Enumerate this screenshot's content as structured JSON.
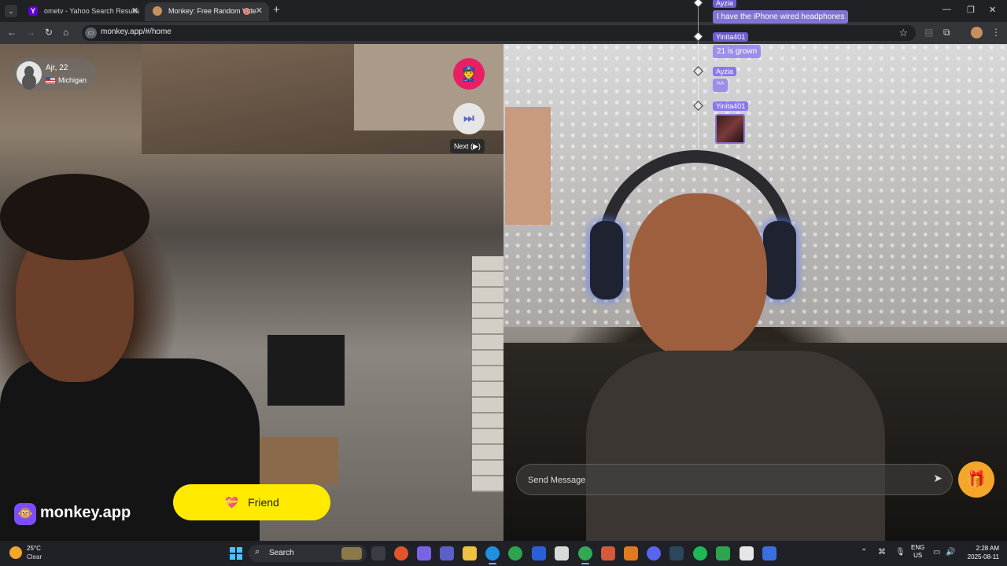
{
  "browser": {
    "tabs": [
      {
        "title": "ometv - Yahoo Search Results"
      },
      {
        "title": "Monkey: Free Random Vide"
      }
    ],
    "url": "monkey.app/#/home"
  },
  "caller": {
    "name": "Ajr, 22",
    "location": "Michigan"
  },
  "controls": {
    "next_tooltip": "Next (▶)",
    "friend_label": "Friend"
  },
  "brand": {
    "name": "monkey.app"
  },
  "chat": {
    "messages": [
      {
        "author": "Ayzia",
        "text": "I have the iPhone wired headphones"
      },
      {
        "author": "Yinita401",
        "text": "21 is grown"
      },
      {
        "author": "Ayzia",
        "text": "^^"
      },
      {
        "author": "Yinita401",
        "text": ""
      }
    ],
    "send_placeholder": "Send Message"
  },
  "taskbar": {
    "weather_temp": "25°C",
    "weather_condition": "Clear",
    "search_label": "Search",
    "lang_line1": "ENG",
    "lang_line2": "US",
    "time": "2:28 AM",
    "date": "2025-08-11"
  }
}
